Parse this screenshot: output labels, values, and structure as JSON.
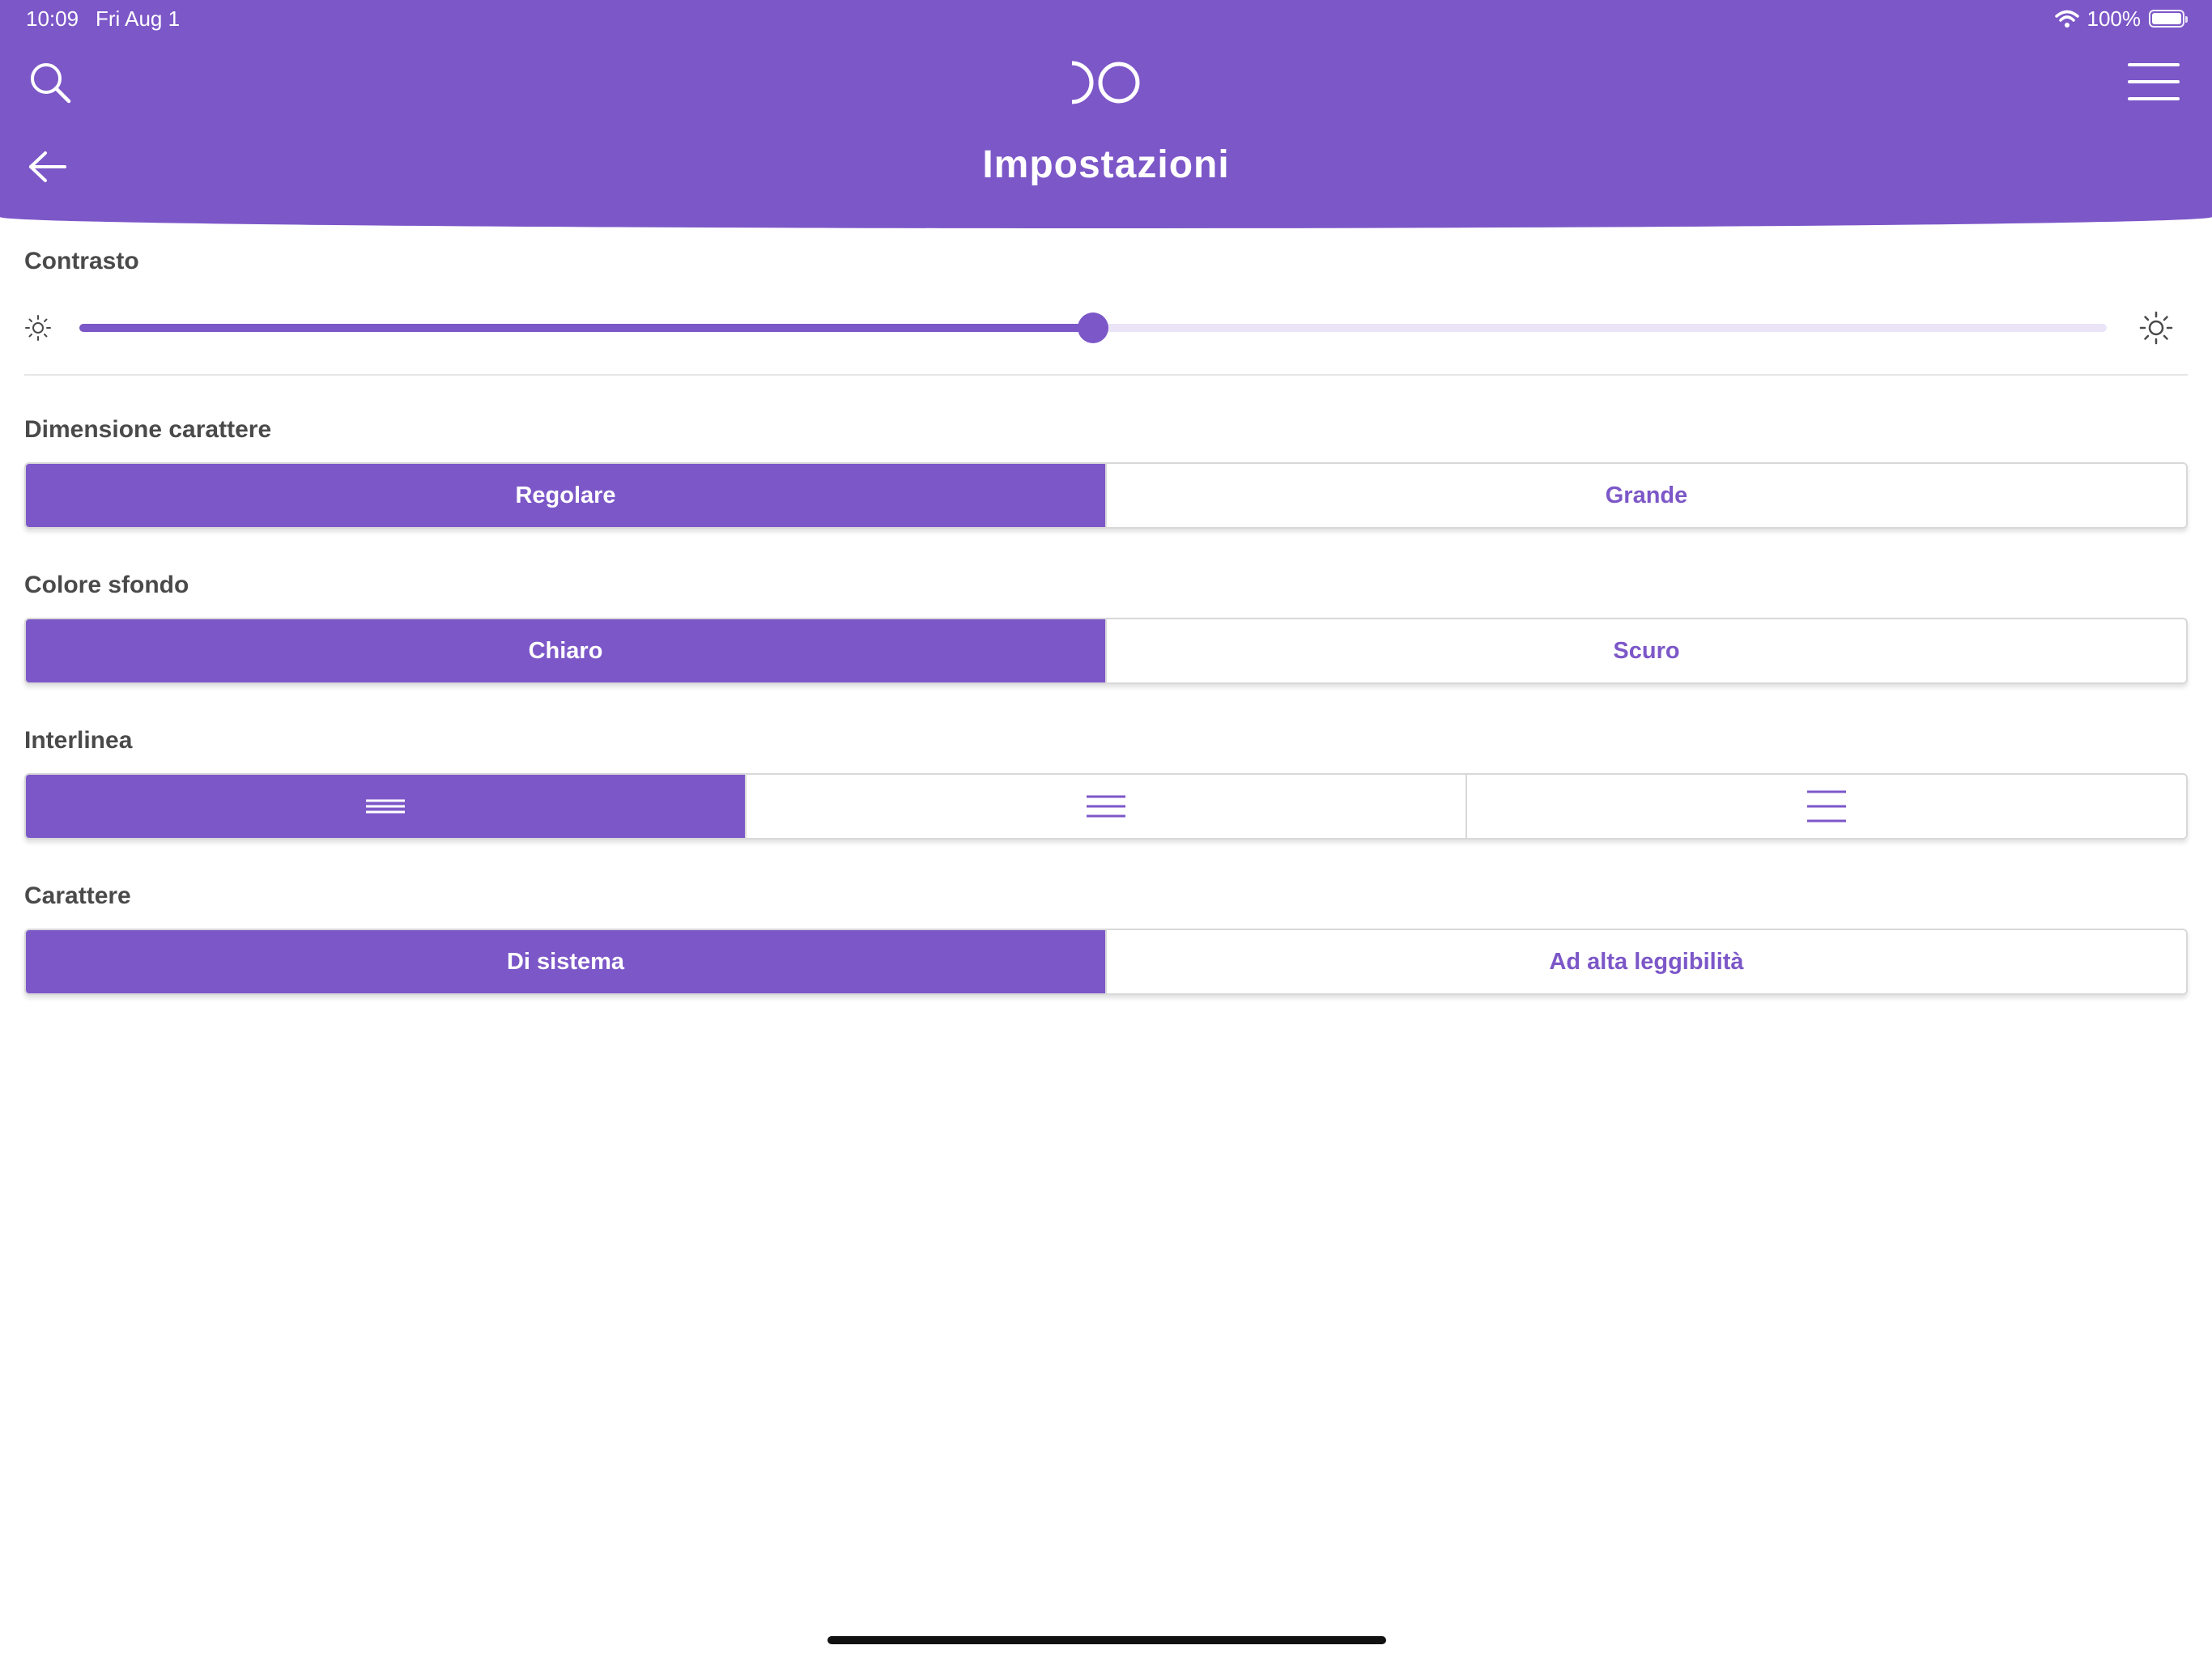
{
  "status_bar": {
    "time": "10:09",
    "date": "Fri Aug 1",
    "battery": "100%"
  },
  "header": {
    "title": "Impostazioni"
  },
  "icons": {
    "search": "search-icon",
    "logo": "logo-icon",
    "menu": "hamburger-menu-icon",
    "back": "back-arrow-icon",
    "brightness_low": "sun-small-icon",
    "brightness_high": "sun-large-icon",
    "line_spacing_tight": "line-spacing-tight-icon",
    "line_spacing_medium": "line-spacing-medium-icon",
    "line_spacing_wide": "line-spacing-wide-icon",
    "wifi": "wifi-icon",
    "battery": "battery-icon"
  },
  "contrast": {
    "label": "Contrasto",
    "value": 0.5
  },
  "font_size": {
    "label": "Dimensione carattere",
    "options": [
      "Regolare",
      "Grande"
    ],
    "selected": 0
  },
  "background_color": {
    "label": "Colore sfondo",
    "options": [
      "Chiaro",
      "Scuro"
    ],
    "selected": 0
  },
  "line_spacing": {
    "label": "Interlinea",
    "selected": 0
  },
  "typeface": {
    "label": "Carattere",
    "options": [
      "Di sistema",
      "Ad alta leggibilità"
    ],
    "selected": 0
  },
  "colors": {
    "accent": "#7c57c8",
    "track_light": "#ebe3f7",
    "text": "#4a4a4a"
  }
}
